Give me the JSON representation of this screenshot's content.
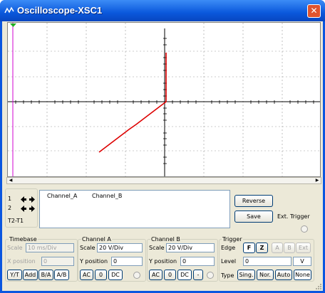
{
  "window": {
    "title": "Oscilloscope-XSC1",
    "close": "✕"
  },
  "cursors": {
    "c1": "1",
    "c2": "2",
    "diff": "T2-T1"
  },
  "readout": {
    "channel_a": "Channel_A",
    "channel_b": "Channel_B"
  },
  "buttons": {
    "reverse": "Reverse",
    "save": "Save",
    "ext_trigger": "Ext. Trigger"
  },
  "timebase": {
    "title": "Timebase",
    "scale_label": "Scale",
    "scale_value": "10  ms/Div",
    "xpos_label": "X position",
    "xpos_value": "0",
    "modes": [
      "Y/T",
      "Add",
      "B/A",
      "A/B"
    ]
  },
  "channel_a": {
    "title": "Channel A",
    "scale_label": "Scale",
    "scale_value": "20  V/Div",
    "ypos_label": "Y position",
    "ypos_value": "0",
    "coupling": [
      "AC",
      "0",
      "DC"
    ]
  },
  "channel_b": {
    "title": "Channel B",
    "scale_label": "Scale",
    "scale_value": "20  V/Div",
    "ypos_label": "Y position",
    "ypos_value": "0",
    "coupling": [
      "AC",
      "0",
      "DC",
      "-"
    ]
  },
  "trigger": {
    "title": "Trigger",
    "edge_label": "Edge",
    "edge_buttons": [
      "F",
      "Z",
      "A",
      "B",
      "Ext"
    ],
    "level_label": "Level",
    "level_value": "0",
    "level_unit": "V",
    "type_label": "Type",
    "type_buttons": [
      "Sing.",
      "Nor.",
      "Auto",
      "None"
    ]
  },
  "colors": {
    "trace": "#dd0000",
    "cursor1": "#d000d0",
    "titlebar": "#0a56e0"
  }
}
